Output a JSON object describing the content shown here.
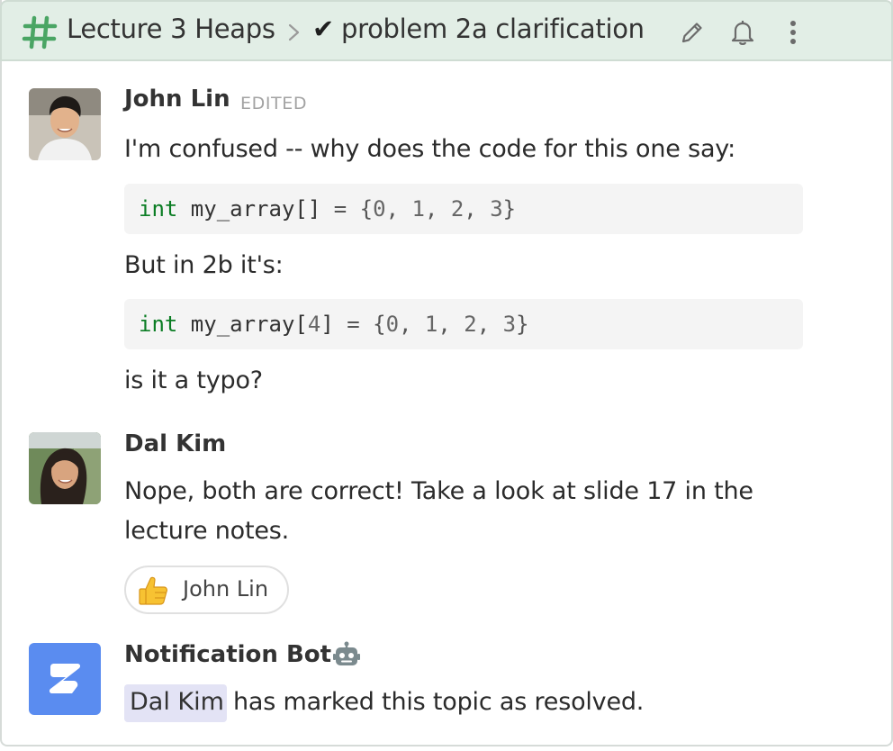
{
  "header": {
    "stream_icon": "hash-icon",
    "stream_name": "Lecture 3 Heaps",
    "separator_icon": "chevron-right-icon",
    "resolved_mark": "✔",
    "topic_name": "problem 2a clarification",
    "actions": [
      "pencil-icon",
      "bell-icon",
      "kebab-menu-icon"
    ],
    "accent_color": "#e2eee6"
  },
  "messages": [
    {
      "sender": "John Lin",
      "edited_label": "EDITED",
      "text_1": "I'm confused -- why does the code for this one say:",
      "code_1": {
        "keyword": "int",
        "name": " my_array[]",
        "rest": " = {",
        "values": [
          "0",
          "1",
          "2",
          "3"
        ],
        "close": "}"
      },
      "text_2": "But in 2b it's:",
      "code_2": {
        "keyword": "int",
        "name": " my_array[",
        "size": "4",
        "name_close": "]",
        "rest": " = {",
        "values": [
          "0",
          "1",
          "2",
          "3"
        ],
        "close": "}"
      },
      "text_3": "is it a typo?"
    },
    {
      "sender": "Dal Kim",
      "text_1": "Nope, both are correct! Take a look at slide 17 in the",
      "text_2": "lecture notes.",
      "reaction": {
        "emoji": "thumbs-up-icon",
        "label": "John Lin"
      }
    },
    {
      "sender": "Notification Bot",
      "bot_icon": "robot-icon",
      "mention": "Dal Kim",
      "text": "has marked this topic as resolved.",
      "avatar_color": "#5a8cf0"
    }
  ]
}
